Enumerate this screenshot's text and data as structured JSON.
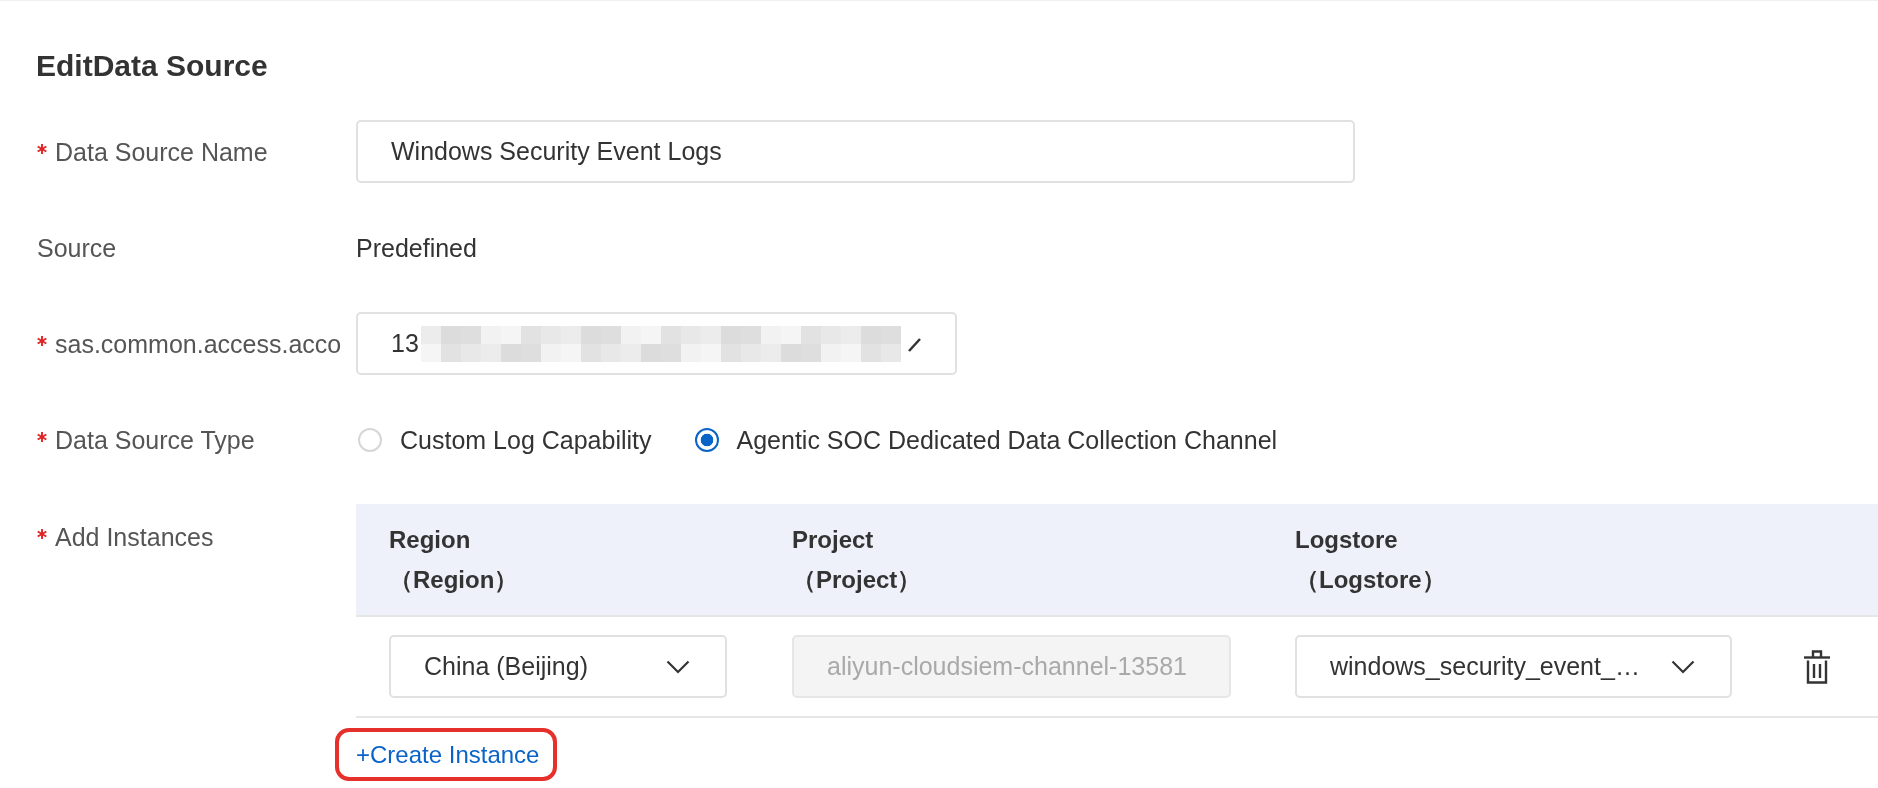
{
  "title": "EditData Source",
  "fields": [
    {
      "kind": "text_input",
      "label": "Data Source Name",
      "required": true,
      "value": "Windows Security Event Logs"
    },
    {
      "kind": "static",
      "label": "Source",
      "required": false,
      "value": "Predefined"
    },
    {
      "kind": "masked_input",
      "label": "sas.common.access.acco",
      "required": true,
      "value": "13"
    },
    {
      "kind": "radio_group",
      "label": "Data Source Type",
      "required": true,
      "options": [
        {
          "label": "Custom Log Capability",
          "selected": false
        },
        {
          "label": "Agentic SOC Dedicated Data Collection Channel",
          "selected": true
        }
      ]
    },
    {
      "kind": "instance_table",
      "label": "Add Instances",
      "required": true,
      "columns": [
        {
          "title": "Region",
          "subtitle": "（Region）"
        },
        {
          "title": "Project",
          "subtitle": "（Project）"
        },
        {
          "title": "Logstore",
          "subtitle": "（Logstore）"
        }
      ],
      "rows": [
        {
          "cells": [
            {
              "kind": "select",
              "value": "China (Beijing)",
              "disabled": false
            },
            {
              "kind": "input",
              "value": "aliyun-cloudsiem-channel-13581",
              "disabled": true
            },
            {
              "kind": "select",
              "value": "windows_security_event_…",
              "disabled": false
            }
          ]
        }
      ],
      "add_link": {
        "label": "+Create Instance",
        "highlighted": true
      }
    }
  ]
}
